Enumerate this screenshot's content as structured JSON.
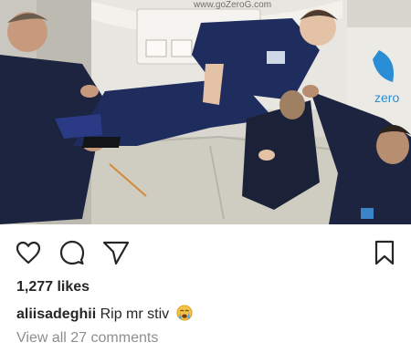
{
  "post": {
    "photo": {
      "icon": "zero-gravity-flight-photo",
      "cabin_sign": "www.goZeroG.com",
      "wall_brand": "zero"
    },
    "actions": {
      "like_icon": "heart-icon",
      "comment_icon": "comment-icon",
      "share_icon": "send-icon",
      "save_icon": "bookmark-icon"
    },
    "likes": "1,277 likes",
    "caption": {
      "username": "aliisadeghii",
      "text": "Rip mr stiv",
      "emoji_icon": "crying-face-emoji"
    },
    "comments_link": "View all 27 comments"
  },
  "colors": {
    "text": "#262626",
    "muted": "#8e8e8e",
    "cabin": "#d8d6cf",
    "flight_suit": "#1f2c5e",
    "brand_blue": "#2a8ed6"
  }
}
